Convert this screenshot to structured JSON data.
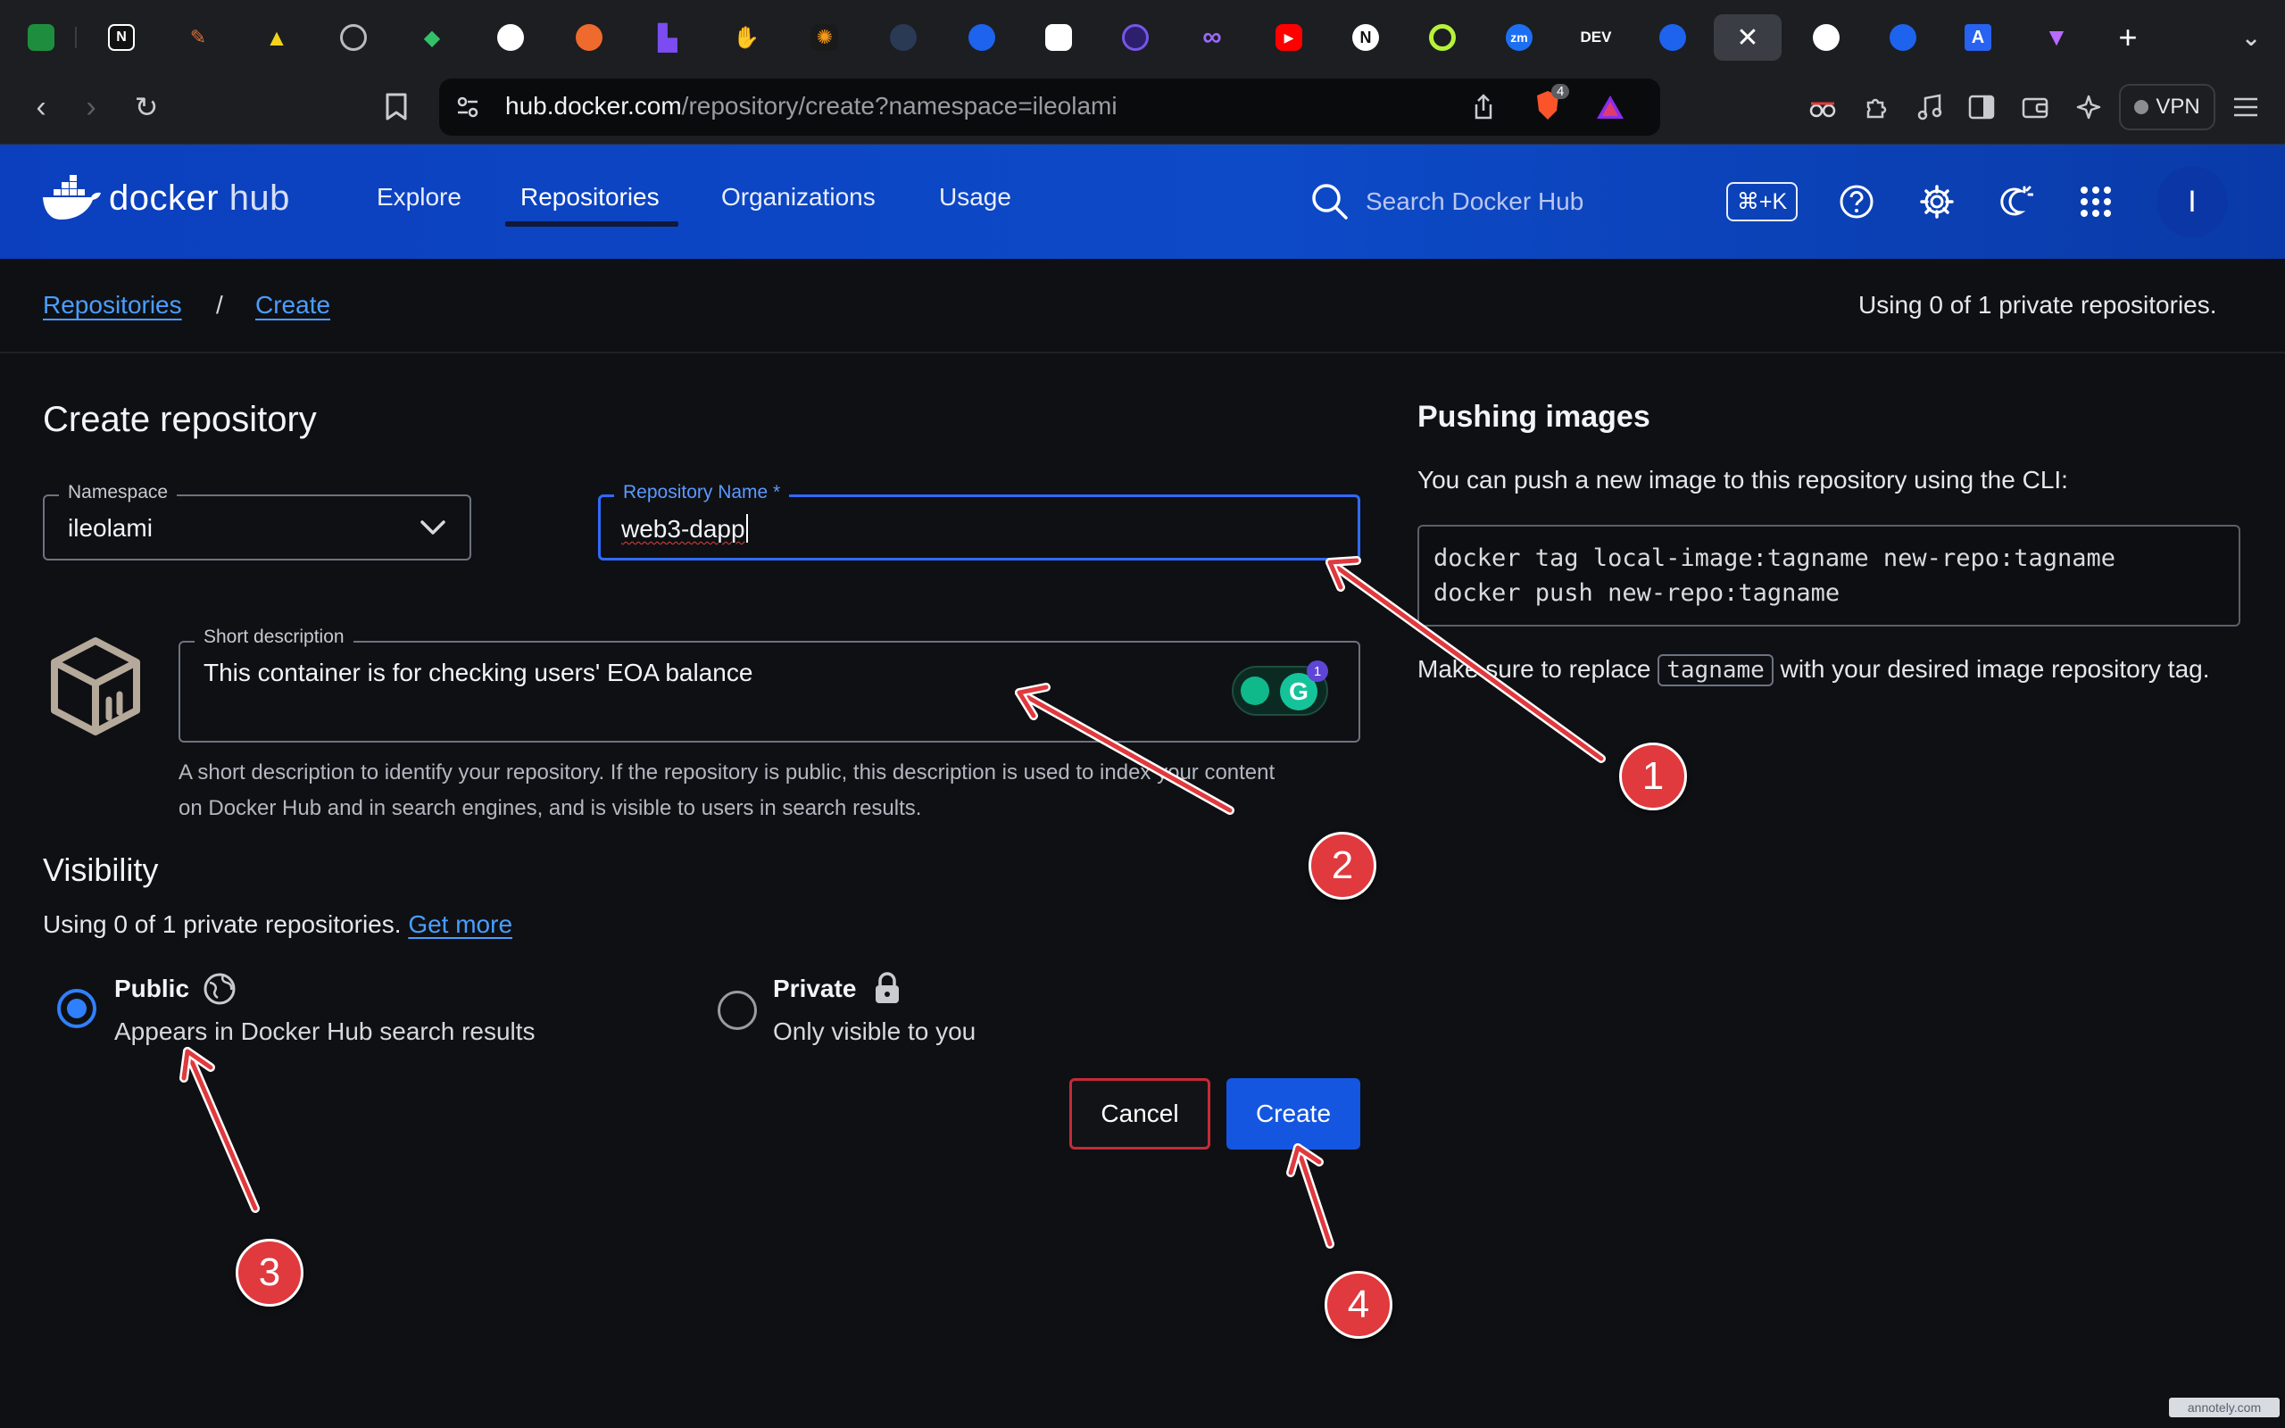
{
  "browser": {
    "url_domain": "hub.docker.com",
    "url_path": "/repository/create?namespace=ileolami",
    "tab_labels": [
      "N",
      "DEV"
    ],
    "brave_shield_count": "4",
    "vpn_label": "VPN",
    "grammarly_count": "1"
  },
  "header": {
    "logo_word1": "docker",
    "logo_word2": "hub",
    "nav": [
      "Explore",
      "Repositories",
      "Organizations",
      "Usage"
    ],
    "search_placeholder": "Search Docker Hub",
    "shortcut": "⌘+K",
    "avatar_initial": "I"
  },
  "breadcrumb": {
    "items": [
      "Repositories",
      "Create"
    ],
    "separator": "/",
    "usage_text": "Using 0 of 1 private repositories."
  },
  "form": {
    "title": "Create repository",
    "namespace_label": "Namespace",
    "namespace_value": "ileolami",
    "repo_name_label": "Repository Name *",
    "repo_name_value": "web3-dapp",
    "short_desc_label": "Short description",
    "short_desc_value": "This container is for checking users' EOA balance",
    "short_desc_helper": "A short description to identify your repository. If the repository is public, this description is used to index your content on Docker Hub and in search engines, and is visible to users in search results.",
    "visibility_title": "Visibility",
    "visibility_usage": "Using 0 of 1 private repositories.",
    "get_more": "Get more",
    "public_title": "Public",
    "public_sub": "Appears in Docker Hub search results",
    "private_title": "Private",
    "private_sub": "Only visible to you",
    "cancel": "Cancel",
    "create": "Create",
    "selected_visibility": "public"
  },
  "pushing": {
    "title": "Pushing images",
    "intro": "You can push a new image to this repository using the CLI:",
    "code_lines": [
      "docker tag local-image:tagname new-repo:tagname",
      "docker push new-repo:tagname"
    ],
    "note_before": "Make sure to replace",
    "note_code": "tagname",
    "note_after": "with your desired image repository tag."
  },
  "annotations": [
    "1",
    "2",
    "3",
    "4"
  ],
  "watermark": "annotely.com",
  "colors": {
    "docker_blue": "#0d4ac8",
    "link_blue": "#4a9eff",
    "create_button": "#1456e0",
    "cancel_border": "#c62a38",
    "annotation_red": "#e0393e"
  }
}
